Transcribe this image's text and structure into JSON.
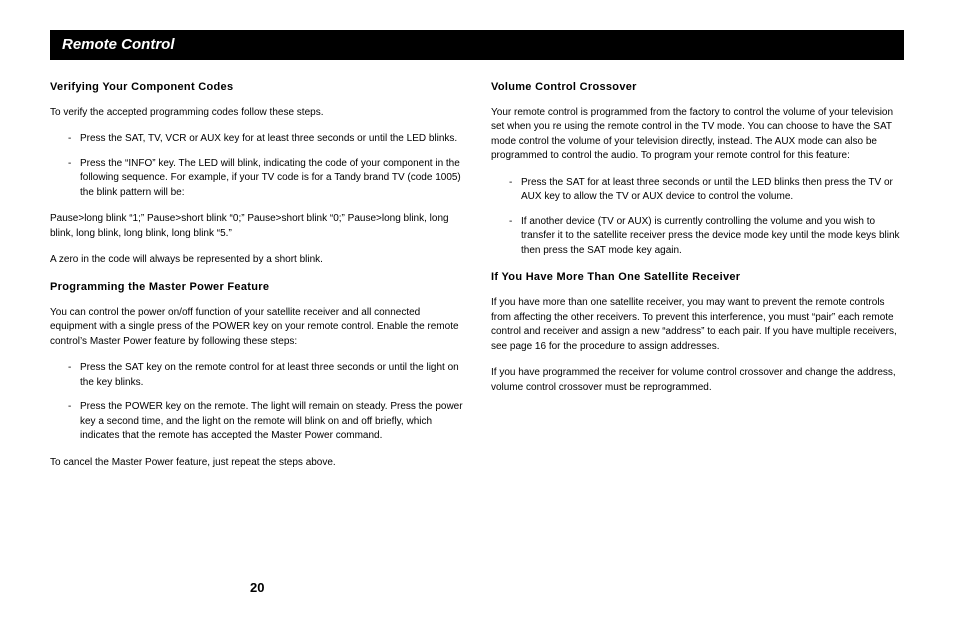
{
  "title": "Remote Control",
  "pageNumber": "20",
  "left": {
    "sec1": {
      "heading": "Verifying Your Component Codes",
      "intro": "To verify the accepted programming codes follow these steps.",
      "items": [
        "Press the SAT, TV, VCR or AUX key for at least three seconds or until the LED blinks.",
        "Press the “INFO” key. The LED will blink, indicating the code of your component in the following sequence. For example, if your TV code is for a Tandy brand TV (code 1005) the blink pattern will be:"
      ],
      "blinkPattern": "Pause>long blink “1;” Pause>short blink “0;” Pause>short blink “0;” Pause>long blink, long blink, long blink, long blink, long blink “5.”",
      "zeroNote": "A zero in the code will always be represented by a short blink."
    },
    "sec2": {
      "heading": "Programming the Master Power Feature",
      "intro": "You can control the power on/off function of your satellite receiver and all connected equipment with a single press of the POWER key on your remote control. Enable the remote control’s Master Power feature by following these steps:",
      "items": [
        "Press the SAT key on the remote control for at least three seconds or until the light on the key blinks.",
        "Press the POWER key on the remote. The light will remain on steady. Press the power key a second time, and the light on the remote will blink on and off briefly, which indicates that the remote has accepted the Master Power command."
      ],
      "cancelNote": "To cancel the Master Power feature, just repeat the steps above."
    }
  },
  "right": {
    "sec1": {
      "heading": "Volume Control Crossover",
      "intro": "Your remote control is programmed from the factory to control the volume of your television set when you re using the remote control in the TV mode. You can choose to have the SAT mode control the volume of your television directly, instead. The AUX mode can also be programmed to control the audio. To program your remote control for this feature:",
      "items": [
        "Press the SAT for at least three seconds or until the LED blinks then press the TV or AUX key to allow the TV or AUX device to control the volume.",
        "If another device (TV or AUX) is currently controlling the volume and you wish to transfer it to the satellite receiver press the device mode key until the mode keys blink then press the SAT mode key again."
      ]
    },
    "sec2": {
      "heading": "If You Have More Than One Satellite Receiver",
      "p1": "If you have more than one satellite receiver, you may want to prevent the remote controls from affecting the other receivers. To prevent this interference, you must “pair” each remote control and receiver and assign a new “address” to each pair. If you have multiple receivers, see page 16 for the procedure to assign addresses.",
      "p2": "If you have programmed the receiver for volume control crossover and change the address, volume control crossover must be reprogrammed."
    }
  }
}
